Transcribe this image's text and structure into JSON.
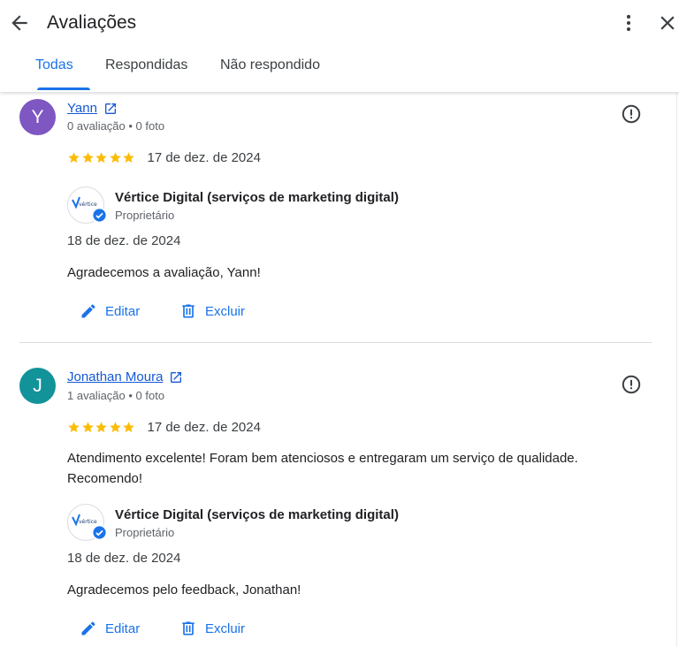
{
  "header": {
    "title": "Avaliações",
    "tabs": [
      {
        "label": "Todas",
        "active": true
      },
      {
        "label": "Respondidas",
        "active": false
      },
      {
        "label": "Não respondido",
        "active": false
      }
    ]
  },
  "colors": {
    "accent": "#1a73e8",
    "star": "#fbbc04",
    "avatar_y": "#7e57c2",
    "avatar_j": "#12939a"
  },
  "reviews": [
    {
      "initial": "Y",
      "name": "Yann",
      "meta": "0 avaliação • 0 foto",
      "rating": 5,
      "date": "17 de dez. de 2024",
      "text": "",
      "reply": {
        "owner": "Vértice Digital (serviços de marketing digital)",
        "role": "Proprietário",
        "logo_text": "vértice",
        "date": "18 de dez. de 2024",
        "text": "Agradecemos a avaliação, Yann!"
      },
      "actions": {
        "edit": "Editar",
        "delete": "Excluir"
      }
    },
    {
      "initial": "J",
      "name": "Jonathan Moura",
      "meta": "1 avaliação • 0 foto",
      "rating": 5,
      "date": "17 de dez. de 2024",
      "text": "Atendimento excelente! Foram bem atenciosos e entregaram um serviço de qualidade. Recomendo!",
      "reply": {
        "owner": "Vértice Digital (serviços de marketing digital)",
        "role": "Proprietário",
        "logo_text": "vértice",
        "date": "18 de dez. de 2024",
        "text": "Agradecemos pelo feedback, Jonathan!"
      },
      "actions": {
        "edit": "Editar",
        "delete": "Excluir"
      }
    }
  ],
  "icons": {
    "back": "arrow-back-icon",
    "more": "more-vert-icon",
    "close": "close-icon",
    "external": "open-in-new-icon",
    "flag": "report-icon",
    "star": "star-icon",
    "edit": "pencil-icon",
    "delete": "trash-icon",
    "verified": "verified-badge-icon"
  }
}
